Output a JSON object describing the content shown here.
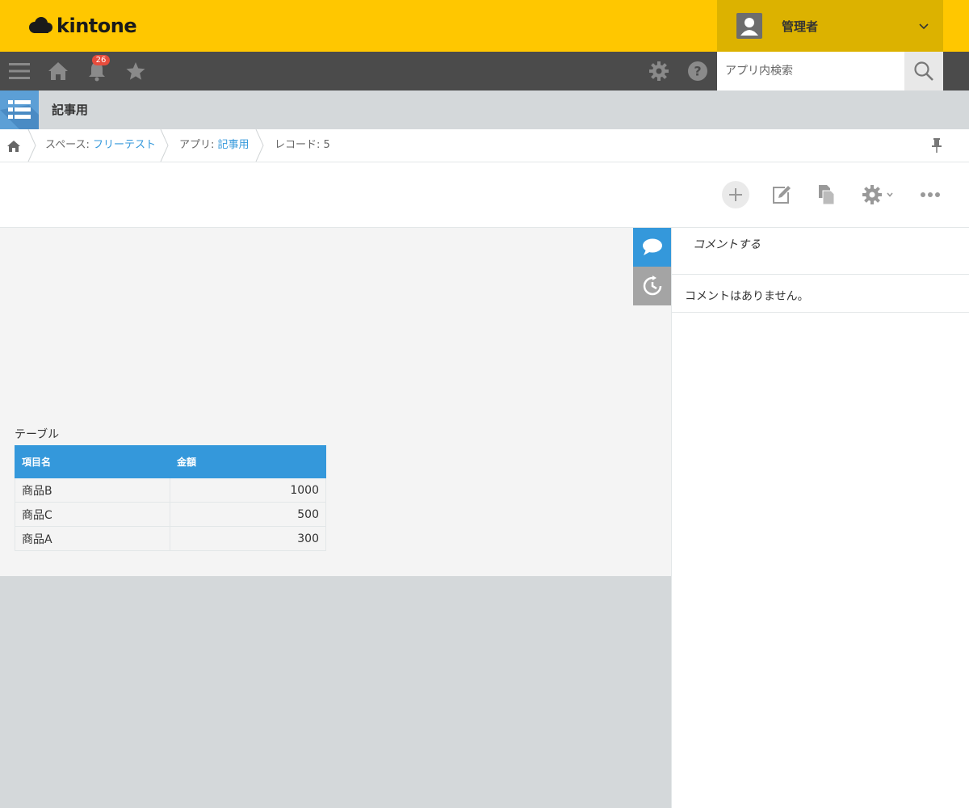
{
  "header": {
    "logo_text": "kintone",
    "user_name": "管理者"
  },
  "nav": {
    "notification_count": "26",
    "search_placeholder": "アプリ内検索",
    "icons": [
      "menu-icon",
      "home-icon",
      "bell-icon",
      "star-icon",
      "gear-icon",
      "help-icon",
      "search-icon"
    ]
  },
  "app": {
    "title": "記事用"
  },
  "breadcrumb": {
    "space_prefix": "スペース: ",
    "space_name": "フリーテスト",
    "app_prefix": "アプリ: ",
    "app_name": "記事用",
    "record_label": "レコード: 5"
  },
  "record": {
    "table_label": "テーブル",
    "columns": [
      "項目名",
      "金額"
    ],
    "rows": [
      {
        "name": "商品B",
        "amount": "1000"
      },
      {
        "name": "商品C",
        "amount": "500"
      },
      {
        "name": "商品A",
        "amount": "300"
      }
    ]
  },
  "comments": {
    "input_placeholder": "コメントする",
    "empty_message": "コメントはありません。"
  },
  "colors": {
    "header_yellow": "#ffc700",
    "user_menu_bg": "#dcb200",
    "nav_dark": "#4b4b4b",
    "accent_blue": "#3498db",
    "badge_red": "#e74c3c"
  }
}
